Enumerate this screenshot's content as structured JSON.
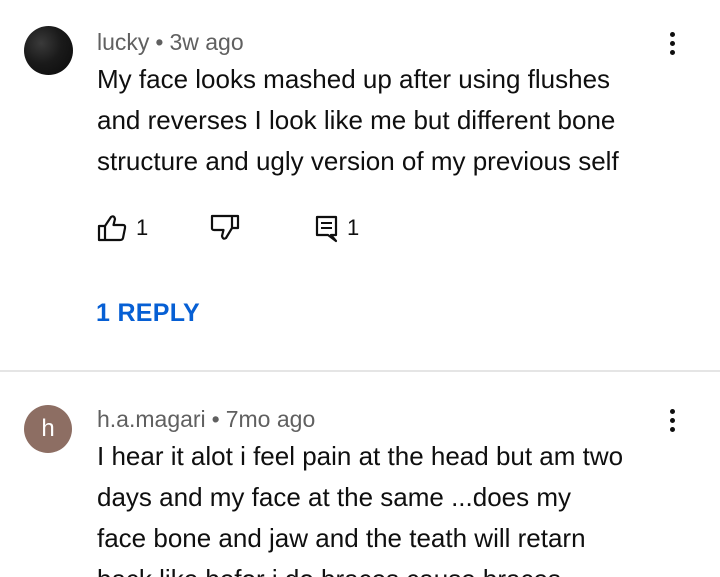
{
  "comments": [
    {
      "author": "lucky",
      "separator": "•",
      "time": "3w ago",
      "text": "My face looks mashed up after using flushes\nand reverses I look like me but different bone\nstructure and ugly version of my previous self",
      "likes": "1",
      "replies_count": "1",
      "reply_link": "1 REPLY",
      "avatar": "dark-photo-avatar"
    },
    {
      "author": "h.a.magari",
      "separator": "•",
      "time": "7mo ago",
      "avatar_letter": "h",
      "avatar_color": "#8d6e63",
      "text": "I hear it alot i feel pain at the head but am two\ndays and  my  face at the same ...does my\nface bone and jaw and the teath will retarn\nback like befor i do braces cause braces"
    }
  ],
  "colors": {
    "link": "#065fd4",
    "meta": "#606060",
    "text": "#0f0f0f",
    "divider": "#e5e5e5"
  },
  "icons": [
    "more-vert-icon",
    "thumb-up-icon",
    "thumb-down-icon",
    "reply-icon"
  ]
}
